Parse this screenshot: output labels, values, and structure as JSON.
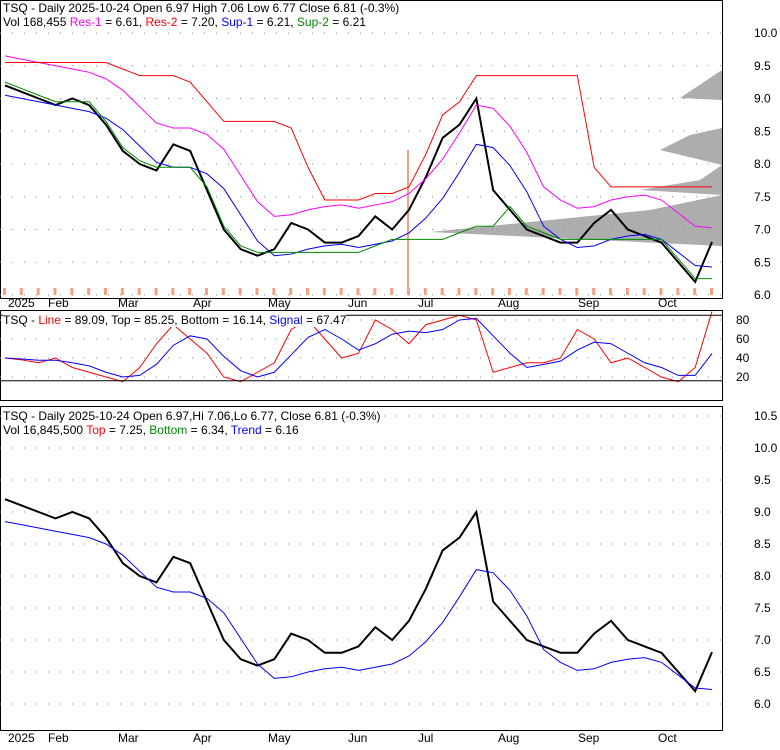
{
  "panel1": {
    "ticker": "TSQ",
    "title": "TSQ - Daily 2025-10-24 Open 6.97  High 7.06  Low 6.77  Close 6.81 (-0.3%)",
    "vol": "Vol 168,455",
    "res1": "Res-1",
    "res1_val": " = 6.61, ",
    "res2": "Res-2",
    "res2_val": " = 7.20, ",
    "sup1": "Sup-1",
    "sup1_val": " = 6.21, ",
    "sup2": "Sup-2",
    "sup2_val": " = 6.21"
  },
  "panel2": {
    "prefix": "TSQ - ",
    "line": "Line",
    "mid": " = 89.09, Top = 85.25, Bottom = 16.14, ",
    "signal": "Signal",
    "signal_val": " = 67.47"
  },
  "panel3": {
    "title": "TSQ - Daily 2025-10-24 Open 6.97,Hi 7.06,Lo 6.77, Close 6.81 (-0.3%)",
    "vol": "Vol 16,845,500 ",
    "top": "Top",
    "top_val": " = 7.25, ",
    "bottom": "Bottom",
    "bottom_val": " = 6.34, ",
    "trend": "Trend",
    "trend_val": " = 6.16"
  },
  "colors": {
    "res1": "#ff00ff",
    "res2": "#ff0000",
    "sup1": "#0000ff",
    "sup2": "#008000"
  },
  "chart_data": {
    "type": "line",
    "months": [
      "2025",
      "Feb",
      "Mar",
      "Apr",
      "May",
      "Jun",
      "Jul",
      "Aug",
      "Sep",
      "Oct"
    ],
    "price_ticks1": [
      "10.0",
      "9.5",
      "9.0",
      "8.5",
      "8.0",
      "7.5",
      "7.0",
      "6.5",
      "6.0"
    ],
    "price_ticks3": [
      "10.5",
      "10.0",
      "9.5",
      "9.0",
      "8.5",
      "8.0",
      "7.5",
      "7.0",
      "6.5",
      "6.0"
    ],
    "osc_ticks": [
      "80",
      "60",
      "40",
      "20"
    ],
    "close": [
      9.2,
      9.1,
      9.0,
      8.9,
      9.0,
      8.9,
      8.6,
      8.2,
      8.0,
      7.9,
      8.3,
      8.2,
      7.6,
      7.0,
      6.7,
      6.6,
      6.7,
      7.1,
      7.0,
      6.8,
      6.8,
      6.9,
      7.2,
      7.0,
      7.3,
      7.8,
      8.4,
      8.6,
      9.0,
      7.6,
      7.3,
      7.0,
      6.9,
      6.8,
      6.8,
      7.1,
      7.3,
      7.0,
      6.9,
      6.8,
      6.5,
      6.2,
      6.81
    ],
    "oscillator": [
      40,
      38,
      35,
      40,
      30,
      25,
      20,
      15,
      30,
      55,
      75,
      60,
      45,
      20,
      15,
      25,
      35,
      70,
      80,
      60,
      40,
      45,
      80,
      70,
      55,
      75,
      80,
      85,
      80,
      25,
      30,
      35,
      35,
      40,
      70,
      60,
      35,
      40,
      30,
      20,
      15,
      30,
      89
    ]
  }
}
